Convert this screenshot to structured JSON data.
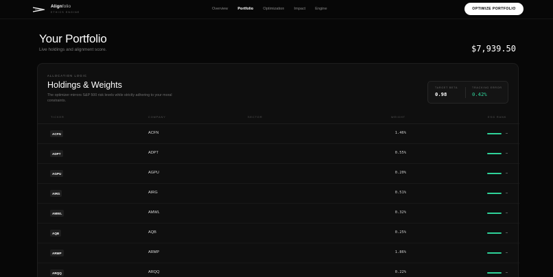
{
  "brand": {
    "name_bold": "Align",
    "name_light": "folio",
    "tagline": "ETHICS ENGINE"
  },
  "nav": {
    "links": [
      {
        "label": "Overview",
        "active": false
      },
      {
        "label": "Portfolio",
        "active": true
      },
      {
        "label": "Optimization",
        "active": false
      },
      {
        "label": "Impact",
        "active": false
      },
      {
        "label": "Engine",
        "active": false
      }
    ],
    "cta_label": "OPTIMIZE PORTFOLIO"
  },
  "header": {
    "title": "Your Portfolio",
    "subtitle": "Live holdings and alignment score.",
    "total_value": "$7,939.50"
  },
  "card": {
    "eyebrow": "ALLOCATION LOGIC",
    "title": "Holdings & Weights",
    "description": "The optimizer mirrors S&P 500 risk levels while strictly adhering to your moral constraints.",
    "stats": {
      "target_beta_label": "TARGET BETA",
      "target_beta_value": "0.98",
      "tracking_error_label": "TRACKING ERROR",
      "tracking_error_value": "0.42%"
    },
    "columns": {
      "ticker": "TICKER",
      "company": "COMPANY",
      "sector": "SECTOR",
      "weight": "WEIGHT",
      "esg_rank": "ESG RANK"
    },
    "rows": [
      {
        "ticker": "ACFN",
        "company": "ACFN",
        "sector": "",
        "weight": "1.46%",
        "esg_rank": 0.8
      },
      {
        "ticker": "ADPT",
        "company": "ADPT",
        "sector": "",
        "weight": "0.55%",
        "esg_rank": 0.8
      },
      {
        "ticker": "AGPU",
        "company": "AGPU",
        "sector": "",
        "weight": "0.20%",
        "esg_rank": 0.8
      },
      {
        "ticker": "AIRG",
        "company": "AIRG",
        "sector": "",
        "weight": "0.51%",
        "esg_rank": 0.8
      },
      {
        "ticker": "AMWL",
        "company": "AMWL",
        "sector": "",
        "weight": "0.32%",
        "esg_rank": 0.8
      },
      {
        "ticker": "AQB",
        "company": "AQB",
        "sector": "",
        "weight": "0.25%",
        "esg_rank": 0.8
      },
      {
        "ticker": "ARMP",
        "company": "ARMP",
        "sector": "",
        "weight": "1.86%",
        "esg_rank": 0.8
      },
      {
        "ticker": "ARQQ",
        "company": "ARQQ",
        "sector": "",
        "weight": "0.22%",
        "esg_rank": 0.8
      }
    ]
  },
  "colors": {
    "accent": "#2fd39a",
    "background": "#070707",
    "card": "#0f0f0f"
  }
}
